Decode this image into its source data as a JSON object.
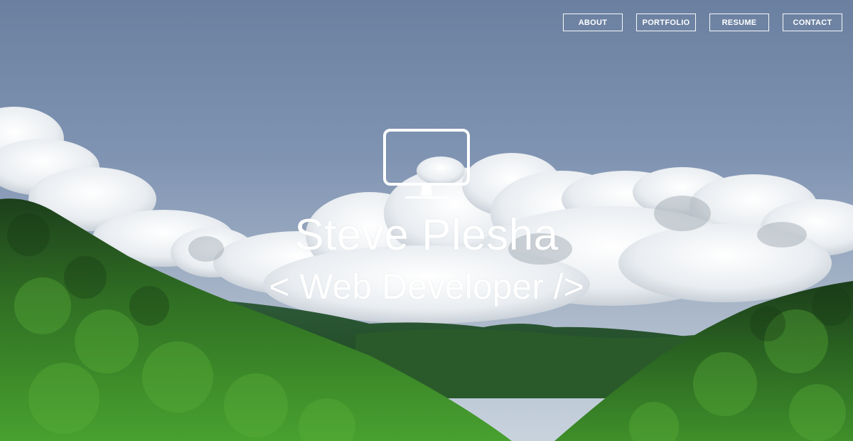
{
  "nav": {
    "items": [
      {
        "label": "ABOUT"
      },
      {
        "label": "PORTFOLIO"
      },
      {
        "label": "RESUME"
      },
      {
        "label": "CONTACT"
      }
    ]
  },
  "hero": {
    "icon": "monitor-icon",
    "name": "Steve Plesha",
    "title": "< Web Developer />"
  },
  "colors": {
    "sky_top": "#6d82a3",
    "sky_mid": "#8ea3bf",
    "cloud": "#f2f4f6",
    "forest_dark": "#1f4a1e",
    "forest_light": "#3f8f2c",
    "text": "#ffffff"
  }
}
